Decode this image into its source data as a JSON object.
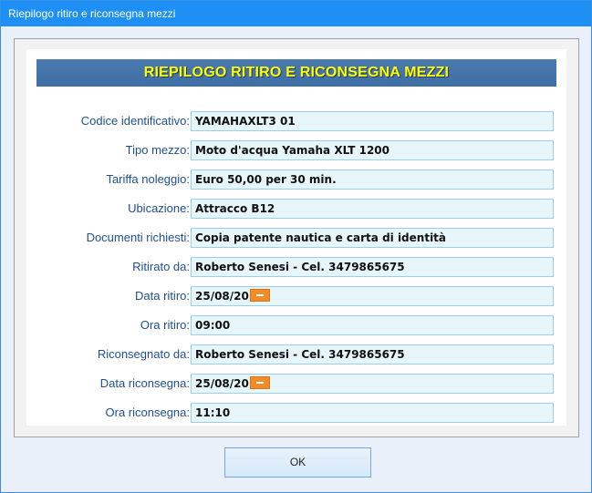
{
  "window": {
    "title": "Riepilogo ritiro e riconsegna mezzi"
  },
  "header": {
    "title": "RIEPILOGO RITIRO E RICONSEGNA MEZZI"
  },
  "rows": [
    {
      "label": "Codice identificativo:",
      "value": "YAMAHAXLT3 01"
    },
    {
      "label": "Tipo mezzo:",
      "value": "Moto d'acqua Yamaha XLT 1200"
    },
    {
      "label": "Tariffa noleggio:",
      "value": "Euro 50,00 per 30 min."
    },
    {
      "label": "Ubicazione:",
      "value": "Attracco B12"
    },
    {
      "label": "Documenti richiesti:",
      "value": "Copia patente nautica e carta di identità"
    },
    {
      "label": "Ritirato da:",
      "value": "Roberto Senesi - Cel. 3479865675"
    },
    {
      "label": "Data ritiro:",
      "value": "25/08/20"
    },
    {
      "label": "Ora ritiro:",
      "value": "09:00"
    },
    {
      "label": "Riconsegnato da:",
      "value": "Roberto Senesi - Cel. 3479865675"
    },
    {
      "label": "Data riconsegna:",
      "value": "25/08/20"
    },
    {
      "label": "Ora riconsegna:",
      "value": "11:10"
    }
  ],
  "buttons": {
    "ok": "OK"
  },
  "icons": {
    "calendar": "calendar-icon"
  },
  "colors": {
    "titlebar": "#1e90f5",
    "header_bg": "#4274aa",
    "header_text": "#ffff00",
    "label_text": "#1f4f8f",
    "field_bg": "#e6f6fb",
    "calendar": "#f28c28"
  }
}
